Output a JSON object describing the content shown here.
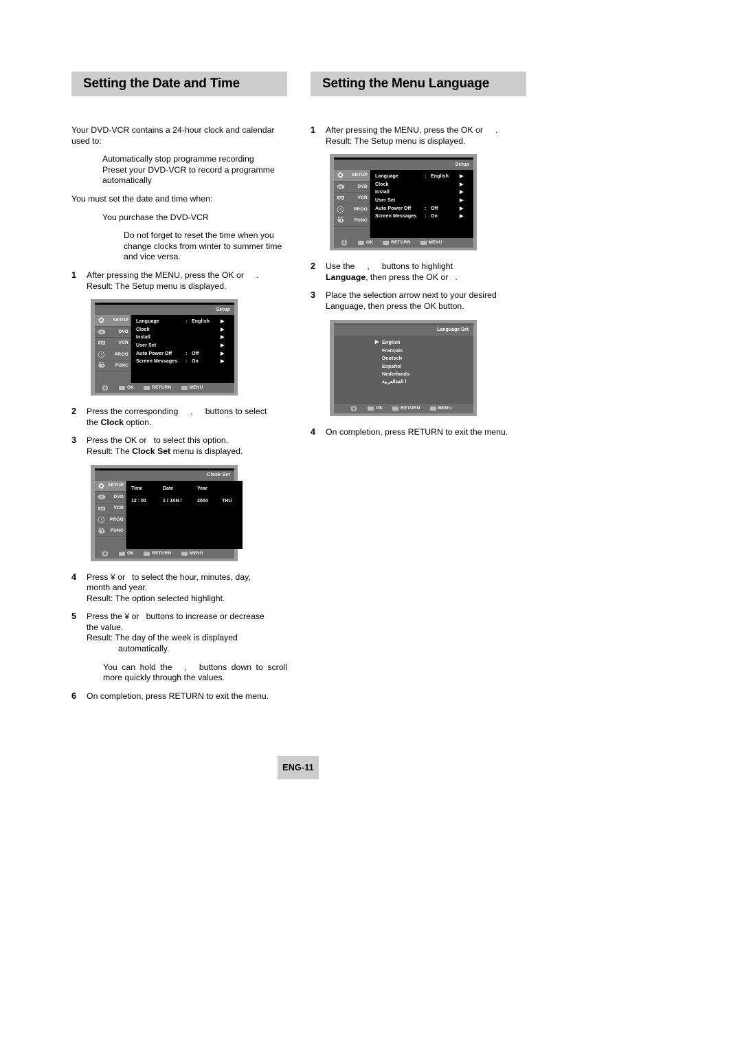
{
  "left": {
    "heading": "Setting the Date and Time",
    "intro": "Your DVD-VCR contains a 24-hour clock and calendar used to:",
    "bullets": [
      "Automatically stop programme recording",
      "Preset your DVD-VCR to record a programme automatically"
    ],
    "must": "You must set the date and time when:",
    "must_item": "You purchase the DVD-VCR",
    "note": "Do not forget to reset the time when you change clocks from winter to summer time and vice versa.",
    "steps": [
      {
        "num": "1",
        "line1_a": "After pressing the MENU, press the OK or",
        "line1_b": ".",
        "result_label": "Result:",
        "result_text": "The Setup menu is displayed."
      },
      {
        "num": "2",
        "line1_a": "Press the corresponding",
        "line1_mid": ",",
        "line1_b": "buttons to select",
        "line2_a": "the",
        "line2_bold": "Clock",
        "line2_b": "option."
      },
      {
        "num": "3",
        "line1_a": "Press the OK or",
        "line1_b": "to select this option.",
        "result_label": "Result:",
        "result_a": "The",
        "result_bold": "Clock Set",
        "result_b": "menu is displayed."
      },
      {
        "num": "4",
        "line1_a": "Press ¥ or",
        "line1_b": "to select the hour, minutes, day,",
        "line2": "month and year.",
        "result_label": "Result:",
        "result_text": "The option selected highlight."
      },
      {
        "num": "5",
        "line1_a": "Press the ¥ or",
        "line1_b": "buttons to increase or decrease",
        "line2": "the value.",
        "result_label": "Result:",
        "result_text": "The day of the week is displayed",
        "result_text2": "automatically.",
        "sub_a": "You can hold the",
        "sub_mid": ",",
        "sub_b": "buttons down to scroll more quickly through the values."
      },
      {
        "num": "6",
        "line1_a": "On completion, press RETURN to exit the menu."
      }
    ]
  },
  "right": {
    "heading": "Setting the Menu Language",
    "steps": [
      {
        "num": "1",
        "line1_a": "After pressing the MENU, press the OK or",
        "line1_b": ".",
        "result_label": "Result:",
        "result_text": "The Setup menu is displayed."
      },
      {
        "num": "2",
        "line1_a": "Use the",
        "line1_mid": ",",
        "line1_b": "buttons to highlight",
        "line2_bold": "Language",
        "line2_b": ", then press the OK or",
        "line2_c": "."
      },
      {
        "num": "3",
        "line1_a": "Place the selection arrow next to your desired",
        "line2": "Language, then press the OK button."
      },
      {
        "num": "4",
        "line1_a": "On completion, press RETURN to exit the menu."
      }
    ]
  },
  "setup_screen": {
    "title": "Setup",
    "sidebar": [
      {
        "label": "SETUP",
        "icon": "gear-icon",
        "active": true
      },
      {
        "label": "DVD",
        "icon": "dvd-disc-icon",
        "active": false
      },
      {
        "label": "VCR",
        "icon": "vcr-cassette-icon",
        "active": false
      },
      {
        "label": "PROG",
        "icon": "clock-icon",
        "active": false
      },
      {
        "label": "FUNC",
        "icon": "function-hand-icon",
        "active": false
      }
    ],
    "rows": [
      {
        "label": "Language",
        "colon": ":",
        "value": "English",
        "arrow": "▶"
      },
      {
        "label": "Clock",
        "colon": "",
        "value": "",
        "arrow": "▶"
      },
      {
        "label": "Install",
        "colon": "",
        "value": "",
        "arrow": "▶"
      },
      {
        "label": "User Set",
        "colon": "",
        "value": "",
        "arrow": "▶"
      },
      {
        "label": "Auto Power Off",
        "colon": ":",
        "value": "Off",
        "arrow": "▶"
      },
      {
        "label": "Screen Messages",
        "colon": ":",
        "value": "On",
        "arrow": "▶"
      }
    ],
    "bottom": [
      {
        "label": "OK",
        "icon": "ok-button-icon"
      },
      {
        "label": "RETURN",
        "icon": "return-button-icon"
      },
      {
        "label": "MENU",
        "icon": "menu-button-icon"
      }
    ]
  },
  "clock_screen": {
    "title": "Clock Set",
    "sidebar": [
      {
        "label": "SETUP",
        "icon": "gear-icon",
        "active": true
      },
      {
        "label": "DVD",
        "icon": "dvd-disc-icon",
        "active": false
      },
      {
        "label": "VCR",
        "icon": "vcr-cassette-icon",
        "active": false
      },
      {
        "label": "PROG",
        "icon": "clock-icon",
        "active": false
      },
      {
        "label": "FUNC",
        "icon": "function-hand-icon",
        "active": false
      }
    ],
    "headers": [
      "Time",
      "Date",
      "Year",
      ""
    ],
    "values": [
      "12 : 00",
      "1 / JAN /",
      "2004",
      "THU"
    ],
    "bottom": [
      {
        "label": "OK",
        "icon": "ok-button-icon"
      },
      {
        "label": "RETURN",
        "icon": "return-button-icon"
      },
      {
        "label": "MENU",
        "icon": "menu-button-icon"
      }
    ]
  },
  "language_screen": {
    "title": "Language Set",
    "options": [
      {
        "label": "English",
        "selected": true
      },
      {
        "label": "Français",
        "selected": false
      },
      {
        "label": "Deutsch",
        "selected": false
      },
      {
        "label": "Español",
        "selected": false
      },
      {
        "label": "Nederlands",
        "selected": false
      },
      {
        "label": "ا الفةالعربية",
        "selected": false
      }
    ],
    "bottom": [
      {
        "label": "OK",
        "icon": "ok-button-icon"
      },
      {
        "label": "RETURN",
        "icon": "return-button-icon"
      },
      {
        "label": "MENU",
        "icon": "menu-button-icon"
      }
    ]
  },
  "footer": {
    "page": "ENG-11"
  },
  "colors": {
    "heading_bar": "#cdcdcd",
    "screen_bezel": "#9a9a9a",
    "screen_chrome": "#6e6e6e",
    "screen_body": "#000000",
    "language_body": "#5e5e5e",
    "text": "#000000"
  }
}
